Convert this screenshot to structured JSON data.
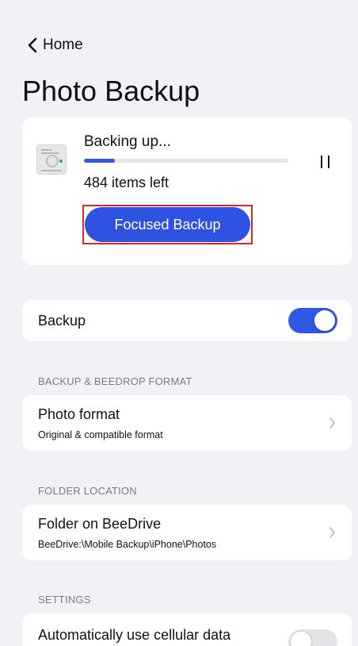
{
  "nav": {
    "back_label": "Home"
  },
  "title": "Photo Backup",
  "status": {
    "title": "Backing up...",
    "progress": 0.15,
    "items_left": "484 items left",
    "focused_button": "Focused Backup"
  },
  "backup": {
    "label": "Backup",
    "enabled": true
  },
  "format_section": {
    "header": "BACKUP & BEEDROP FORMAT",
    "title": "Photo format",
    "subtitle": "Original & compatible format"
  },
  "folder_section": {
    "header": "FOLDER LOCATION",
    "title": "Folder on BeeDrive",
    "subtitle": "BeeDrive:\\Mobile Backup\\iPhone\\Photos"
  },
  "settings_section": {
    "header": "SETTINGS",
    "cellular_label": "Automatically use cellular data",
    "cellular_enabled": false
  },
  "colors": {
    "accent": "#2f59e4",
    "background": "#f2f2f6",
    "highlight_border": "#d7262e"
  }
}
